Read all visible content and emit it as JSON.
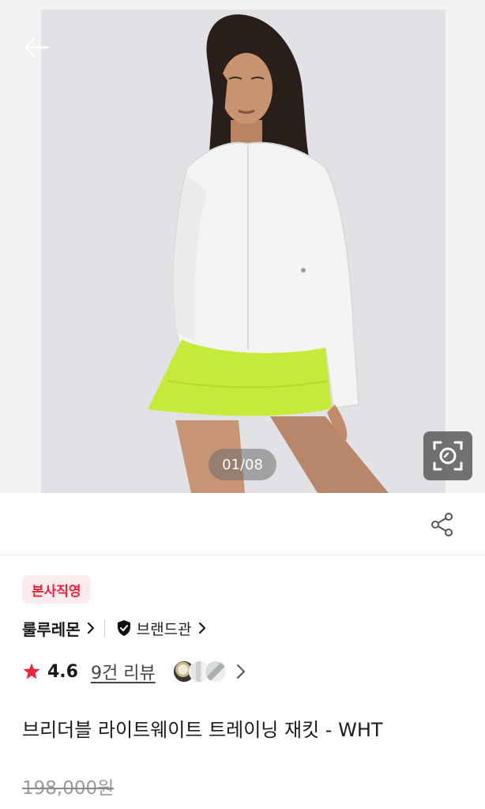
{
  "header": {
    "back_icon": "arrow-left-icon"
  },
  "gallery": {
    "counter": "01/08",
    "lens_icon": "image-search-icon"
  },
  "share": {
    "icon": "share-icon"
  },
  "product": {
    "badge": "본사직영",
    "brand_name": "룰루레몬",
    "brand_hall_label": "브랜드관",
    "rating": "4.6",
    "review_count_label": "9건 리뷰",
    "title": "브리더블 라이트웨이트 트레이닝 재킷 - WHT",
    "original_price": "198,000원"
  },
  "colors": {
    "accent": "#e8243c",
    "badge_bg": "#fdecee",
    "strike_price": "#9a9a9a"
  }
}
